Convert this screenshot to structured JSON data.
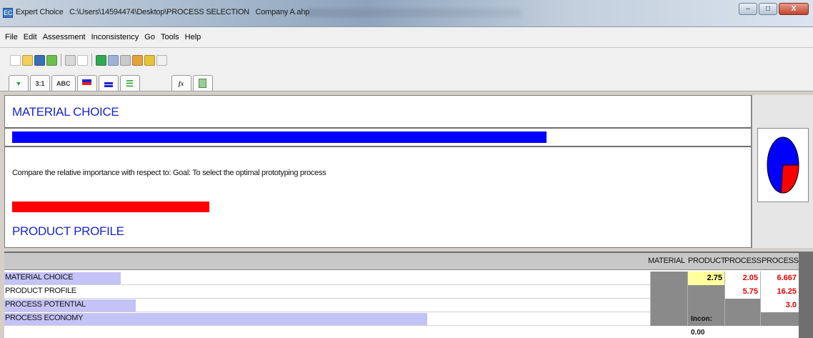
{
  "window": {
    "app_name": "Expert Choice",
    "path": "C:\\Users\\14594474\\Desktop\\PROCESS SELECTION",
    "file": "Company A.ahp",
    "icon_name": "expert-choice-icon"
  },
  "menu": [
    "File",
    "Edit",
    "Assessment",
    "Inconsistency",
    "Go",
    "Tools",
    "Help"
  ],
  "toolbar2_tabs": [
    "3:1",
    "ABC"
  ],
  "fx_label": "fx",
  "compare": {
    "top_criterion": "MATERIAL CHOICE",
    "question": "Compare the relative importance with respect to: Goal: To select the optimal prototyping process",
    "bottom_criterion": "PRODUCT PROFILE",
    "left_fill": 0.73,
    "right_fill": 0.27,
    "pie_left_color": "#0000ff",
    "pie_right_color": "#ff0000"
  },
  "matrix": {
    "columns": [
      "MATERIAL",
      "PRODUCT",
      "PROCESS",
      "PROCESS"
    ],
    "rows": [
      {
        "label": "MATERIAL CHOICE",
        "weight": 0.16,
        "cells": [
          "",
          "2.75",
          "2.05",
          "6.667"
        ]
      },
      {
        "label": "PRODUCT PROFILE",
        "weight": 0.0,
        "cells": [
          "",
          "",
          "5.75",
          "16.25"
        ]
      },
      {
        "label": "PROCESS POTENTIAL",
        "weight": 0.18,
        "cells": [
          "",
          "",
          "",
          "3.0"
        ]
      },
      {
        "label": "PROCESS ECONOMY",
        "weight": 0.58,
        "cells": [
          "",
          "",
          "",
          ""
        ]
      }
    ],
    "inconsistency": "Incon: 0.00"
  },
  "colors": {
    "accent_text": "#1a25c9",
    "bar_blue": "#0000ff",
    "bar_red": "#ff0000",
    "row_bar": "#c3c3f7",
    "judgment_highlight": "#ffff9c",
    "red_value": "#e00000"
  }
}
